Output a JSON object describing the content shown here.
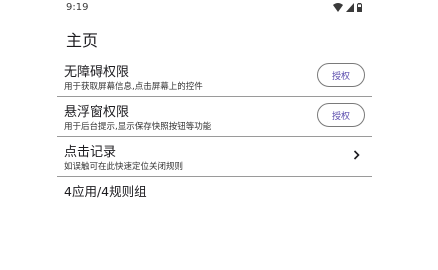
{
  "status_bar": {
    "time": "9:19"
  },
  "page": {
    "title": "主页"
  },
  "rows": [
    {
      "title": "无障碍权限",
      "subtitle": "用于获取屏幕信息,点击屏幕上的控件",
      "button": "授权"
    },
    {
      "title": "悬浮窗权限",
      "subtitle": "用于后台提示,显示保存快照按钮等功能",
      "button": "授权"
    },
    {
      "title": "点击记录",
      "subtitle": "如误触可在此快速定位关闭规则"
    }
  ],
  "summary": "4应用/4规则组",
  "colors": {
    "accent": "#5b4dad",
    "divider": "#9a9a9a"
  }
}
